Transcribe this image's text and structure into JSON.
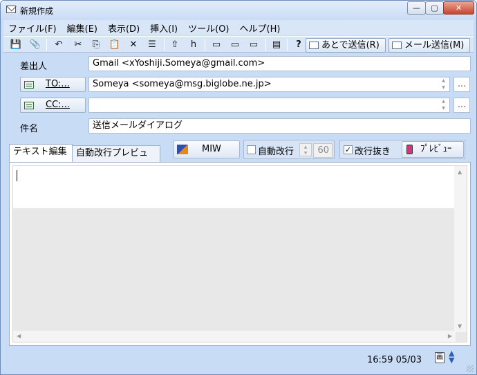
{
  "window": {
    "title": "新規作成",
    "minimize": "—",
    "maximize": "▢",
    "close": "✕"
  },
  "menu": [
    {
      "label": "ファイル(F)"
    },
    {
      "label": "編集(E)"
    },
    {
      "label": "表示(D)"
    },
    {
      "label": "挿入(I)"
    },
    {
      "label": "ツール(O)"
    },
    {
      "label": "ヘルプ(H)"
    }
  ],
  "toolbar": {
    "save": "💾",
    "attach": "📎",
    "undo": "↶",
    "cut": "✂",
    "copy": "⎘",
    "paste": "📋",
    "delete": "✕",
    "format": "☰",
    "upload": "⇧",
    "h": "h",
    "quote1": "▭",
    "quote2": "▭",
    "quote3": "▭",
    "template": "▤",
    "help": "?",
    "send_later": "あとで送信(R)",
    "send_mail": "メール送信(M)"
  },
  "form": {
    "from_label": "差出人",
    "from_value": "Gmail <xYoshiji.Someya@gmail.com>",
    "to_button": "TO:...",
    "to_value": "Someya <someya@msg.biglobe.ne.jp>",
    "cc_button": "CC:...",
    "cc_value": "",
    "subject_label": "件名",
    "subject_value": "送信メールダイアログ",
    "more": "…",
    "spin_up": "▲",
    "spin_down": "▼"
  },
  "tabs": [
    {
      "label": "テキスト編集",
      "active": true
    },
    {
      "label": "自動改行プレビュー",
      "active": false
    }
  ],
  "options": {
    "miw_label": "MIW",
    "auto_wrap_label": "自動改行",
    "auto_wrap_checked": false,
    "wrap_width": "60",
    "strip_newline_label": "改行抜き",
    "strip_newline_checked": true,
    "preview_label": "ﾌﾟﾚﾋﾞｭｰ",
    "check_mark": "✓"
  },
  "editor": {
    "text": "",
    "scroll_up": "▲",
    "scroll_down": "▼",
    "scroll_left": "◀",
    "scroll_right": "▶"
  },
  "status": {
    "time": "16:59 05/03",
    "ime_icon": "画",
    "arrows": "▲▼"
  }
}
